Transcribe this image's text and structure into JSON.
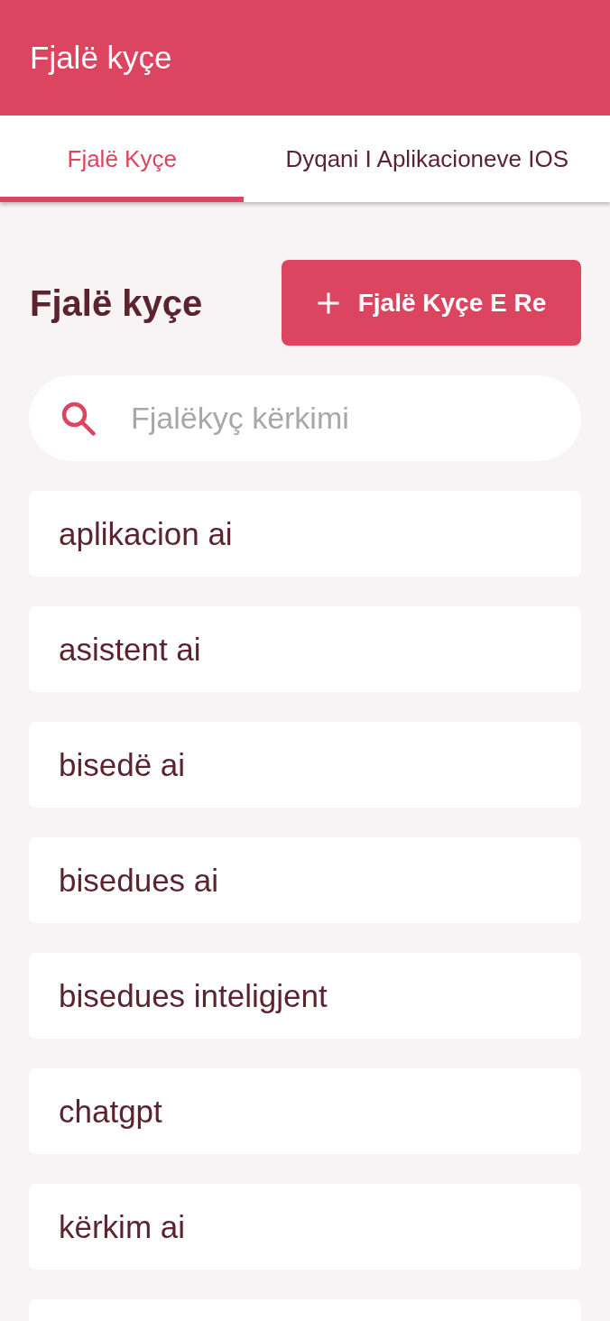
{
  "app_bar": {
    "title": "Fjalë kyçe"
  },
  "tabs": [
    {
      "label": "Fjalë Kyçe",
      "selected": true
    },
    {
      "label": "Dyqani I Aplikacioneve IOS",
      "selected": false
    }
  ],
  "heading": "Fjalë kyçe",
  "add_button": {
    "label": "Fjalë Kyçe E Re"
  },
  "search": {
    "placeholder": "Fjalëkyç kërkimi"
  },
  "keywords": [
    {
      "kind": "keyword",
      "label": "aplikacion ai"
    },
    {
      "kind": "keyword",
      "label": "asistent ai"
    },
    {
      "kind": "keyword",
      "label": "bisedë ai"
    },
    {
      "kind": "keyword",
      "label": "bisedues ai"
    },
    {
      "kind": "keyword",
      "label": "bisedues inteligjent"
    },
    {
      "kind": "keyword",
      "label": "chatgpt"
    },
    {
      "kind": "keyword",
      "label": "kërkim ai"
    },
    {
      "kind": "cut-off"
    }
  ]
}
